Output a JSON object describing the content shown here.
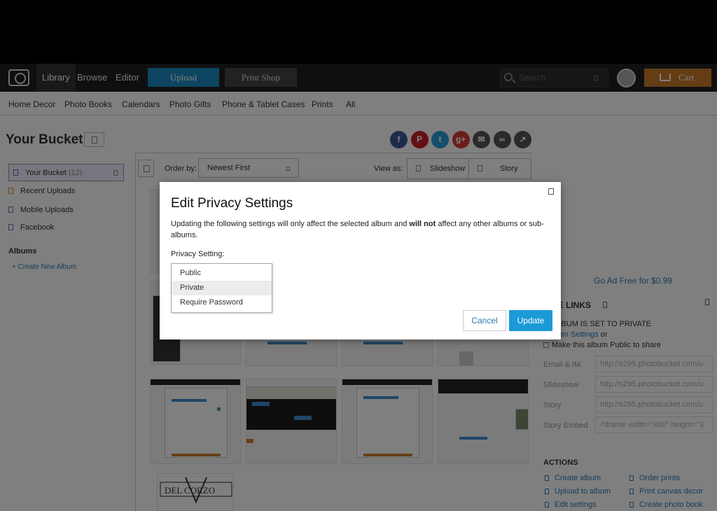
{
  "nav": {
    "library": "Library",
    "browse": "Browse",
    "editor": "Editor",
    "upload": "Upload",
    "print_shop": "Print Shop",
    "search_placeholder": "Search",
    "cart": "Cart"
  },
  "categories": [
    "Home Decor",
    "Photo Books",
    "Calendars",
    "Photo Gifts",
    "Phone & Tablet Cases",
    "Prints",
    "All"
  ],
  "bucket": {
    "title": "Your Bucket"
  },
  "share_icons": [
    {
      "name": "facebook-icon",
      "glyph": "f",
      "color": "#3b5998"
    },
    {
      "name": "pinterest-icon",
      "glyph": "P",
      "color": "#cb2027"
    },
    {
      "name": "twitter-icon",
      "glyph": "t",
      "color": "#2b9bd8"
    },
    {
      "name": "googleplus-icon",
      "glyph": "g+",
      "color": "#d73d32"
    },
    {
      "name": "email-icon",
      "glyph": "✉",
      "color": "#555555"
    },
    {
      "name": "link-icon",
      "glyph": "∞",
      "color": "#555555"
    },
    {
      "name": "share-icon",
      "glyph": "↗",
      "color": "#555555"
    }
  ],
  "sidebar": {
    "items": [
      {
        "label": "Your Bucket",
        "count": "(12)"
      },
      {
        "label": "Recent Uploads"
      },
      {
        "label": "Mobile Uploads"
      },
      {
        "label": "Facebook"
      }
    ],
    "albums_heading": "Albums",
    "create_album": "+ Create New Album"
  },
  "toolbar": {
    "order_by_label": "Order by:",
    "order_by_value": "Newest First",
    "view_as_label": "View as:",
    "view_slideshow": "Slideshow",
    "view_story": "Story"
  },
  "right_panel": {
    "ad_free": "Go Ad Free for $0.99",
    "share_links_heading": "RE LINKS",
    "album_private": "ALBUM IS SET TO PRIVATE",
    "album_settings_link": "lbum Settings",
    "album_settings_suffix": " or",
    "make_public": "Make this album Public to share",
    "fields": [
      {
        "label": "Email & IM",
        "value": "http://s295.photobucket.com/u"
      },
      {
        "label": "Slideshow",
        "value": "http://s295.photobucket.com/u"
      },
      {
        "label": "Story",
        "value": "http://s295.photobucket.com/u"
      },
      {
        "label": "Story Embed",
        "value": "<iframe width=\"480\" height=\"3"
      }
    ],
    "actions_heading": "ACTIONS",
    "actions_left": [
      "Create album",
      "Upload to album",
      "Edit settings"
    ],
    "actions_right": [
      "Order prints",
      "Print canvas decor",
      "Create photo book"
    ]
  },
  "modal": {
    "title": "Edit Privacy Settings",
    "desc_before": "Updating the following settings will only affect the selected album and ",
    "desc_bold": "will not",
    "desc_after": " affect any other albums or sub-albums.",
    "privacy_label": "Privacy Setting:",
    "options": [
      "Public",
      "Private",
      "Require Password"
    ],
    "highlighted_option": "Private",
    "cancel": "Cancel",
    "update": "Update"
  }
}
